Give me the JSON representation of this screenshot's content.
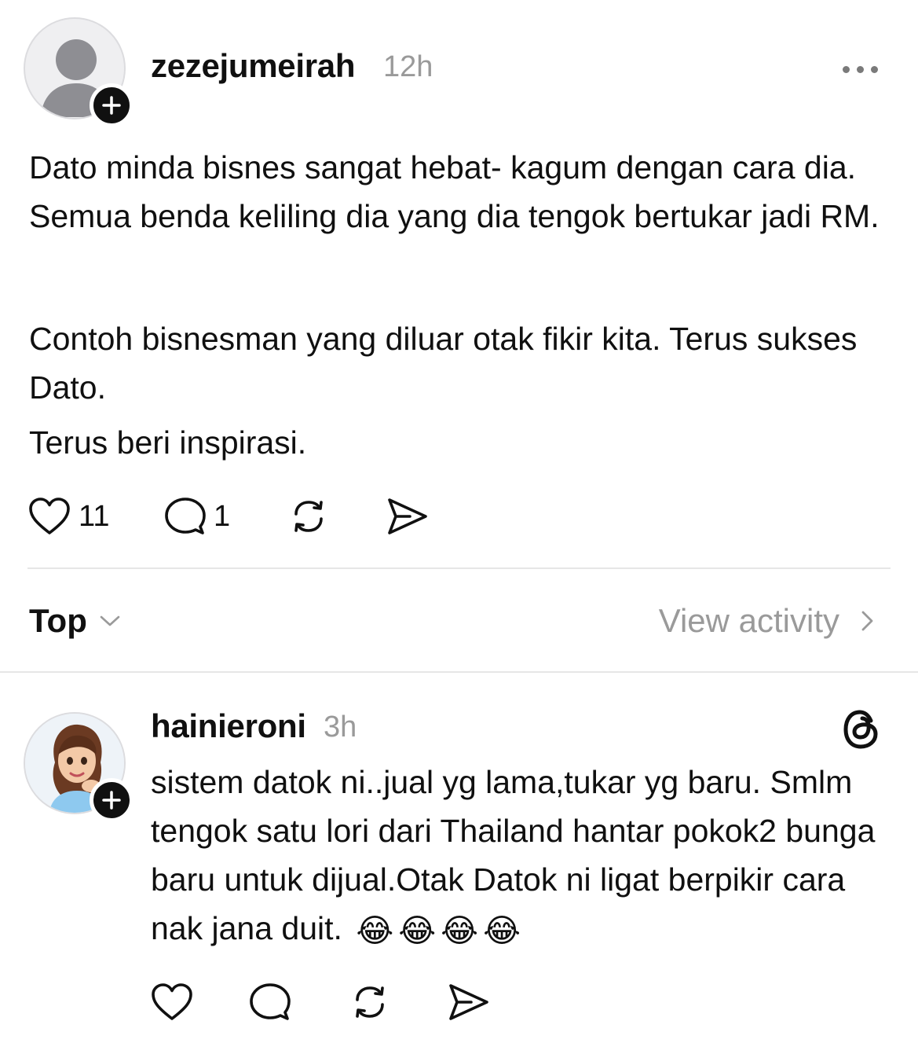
{
  "post": {
    "username": "zezejumeirah",
    "time": "12h",
    "paragraphs": [
      "Dato minda bisnes sangat hebat- kagum dengan cara dia. Semua benda keliling dia yang dia tengok bertukar jadi RM.",
      "Contoh bisnesman yang diluar otak fikir kita. Terus sukses Dato.",
      "Terus beri inspirasi."
    ],
    "likes": "11",
    "comments": "1",
    "icons": [
      "heart-icon",
      "comment-icon",
      "repost-icon",
      "share-icon",
      "more-icon"
    ]
  },
  "sort": {
    "label": "Top",
    "view_activity": "View activity"
  },
  "reply": {
    "username": "hainieroni",
    "time": "3h",
    "text": "sistem datok ni..jual yg lama,tukar yg baru. Smlm tengok satu lori dari Thailand hantar pokok2 bunga baru untuk dijual.Otak Datok ni ligat berpikir cara nak jana duit.",
    "emojis": [
      "😂",
      "😂",
      "😂",
      "😂"
    ]
  },
  "colors": {
    "text": "#101010",
    "muted": "#9a9a9a",
    "divider": "#e6e6e6"
  }
}
